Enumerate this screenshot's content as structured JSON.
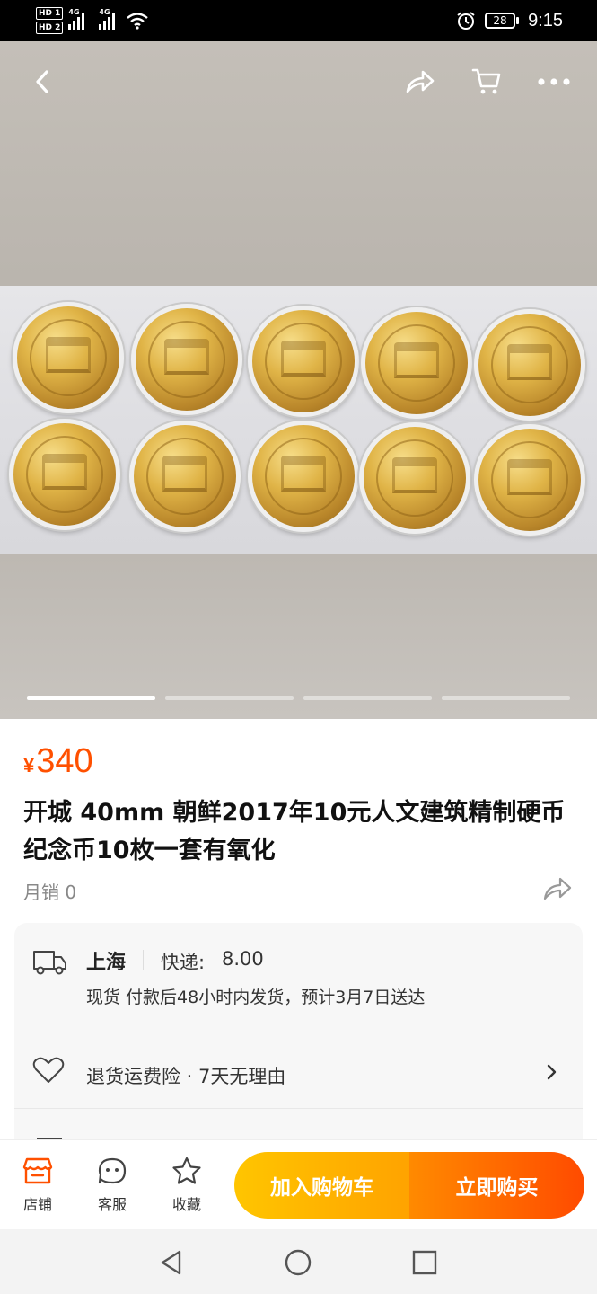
{
  "status_bar": {
    "sim1": "HD 1",
    "sim2": "HD 2",
    "net1": "4G",
    "net2": "4G",
    "battery": "28",
    "time": "9:15"
  },
  "gallery": {
    "total_images": 4,
    "active_index": 1,
    "coins": 10
  },
  "product": {
    "currency": "¥",
    "price": "340",
    "title": "开城 40mm 朝鲜2017年10元人文建筑精制硬币纪念币10枚一套有氧化",
    "sales": "月销 0"
  },
  "shipping": {
    "city": "上海",
    "label": "快递:",
    "fee": "8.00",
    "note": "现货 付款后48小时内发货，预计3月7日送达"
  },
  "service": {
    "text": "退货运费险 · 7天无理由"
  },
  "actions": {
    "store": "店铺",
    "service": "客服",
    "favorite": "收藏",
    "add_cart": "加入购物车",
    "buy_now": "立即购买"
  },
  "colors": {
    "accent": "#ff5000",
    "cart_button": "#ffb300",
    "buy_button": "#ff5a00"
  },
  "icons": {
    "back": "back-arrow-icon",
    "share": "share-icon",
    "cart": "cart-icon",
    "more": "more-icon",
    "truck": "truck-icon",
    "heart": "heart-icon",
    "store": "store-icon",
    "chat": "chat-icon",
    "star": "star-icon"
  }
}
